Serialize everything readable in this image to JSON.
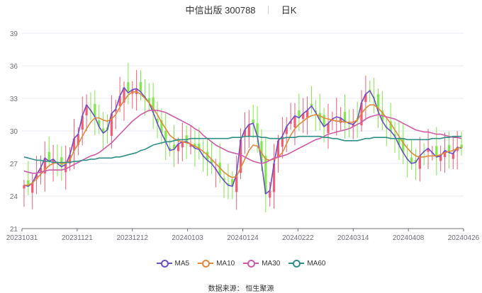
{
  "header": {
    "title": "中信出版 300788",
    "period": "日K"
  },
  "source": "数据来源： 恒生聚源",
  "colors": {
    "up": "#f25c74",
    "down": "#7fe84a",
    "grid": "#e6e9f0",
    "axis": "#6e7079",
    "ma5": "#6a4fc7",
    "ma10": "#e0893a",
    "ma30": "#d05aa8",
    "ma60": "#2f8f86"
  },
  "chart_data": {
    "type": "candlestick",
    "y_ticks": [
      21,
      24,
      27,
      30,
      33,
      36,
      39
    ],
    "ylim": [
      21,
      39
    ],
    "x_ticks": [
      "20231031",
      "20231121",
      "20231212",
      "20240103",
      "20240124",
      "20240222",
      "20240314",
      "20240408",
      "20240426"
    ],
    "legend": [
      "MA5",
      "MA10",
      "MA30",
      "MA60"
    ],
    "approx_close_path": [
      25.0,
      24.9,
      25.2,
      26.0,
      26.6,
      27.5,
      27.2,
      27.4,
      27.0,
      26.7,
      26.9,
      27.8,
      29.3,
      29.7,
      31.4,
      32.4,
      31.9,
      31.3,
      30.4,
      29.8,
      30.1,
      31.6,
      32.0,
      33.2,
      34.0,
      33.5,
      33.8,
      33.9,
      33.6,
      33.1,
      32.6,
      31.7,
      30.7,
      29.8,
      29.0,
      28.2,
      28.3,
      28.8,
      29.0,
      29.0,
      28.8,
      28.4,
      28.3,
      27.7,
      27.3,
      27.0,
      26.5,
      25.9,
      25.4,
      25.0,
      24.9,
      26.0,
      29.2,
      30.1,
      30.6,
      30.7,
      29.5,
      27.1,
      24.2,
      24.5,
      27.0,
      29.1,
      29.5,
      30.4,
      30.9,
      31.4,
      31.2,
      31.6,
      31.9,
      32.3,
      31.7,
      31.0,
      30.4,
      30.7,
      31.1,
      31.3,
      31.2,
      30.9,
      30.7,
      30.6,
      31.0,
      32.6,
      33.4,
      33.7,
      33.0,
      31.8,
      30.9,
      30.3,
      30.0,
      29.5,
      28.7,
      28.0,
      27.4,
      27.0,
      27.1,
      27.7,
      28.1,
      28.4,
      28.0,
      27.6,
      27.7,
      28.2,
      28.0,
      27.9,
      28.5,
      28.4
    ],
    "series": [
      {
        "name": "MA5",
        "values": [
          25.0,
          24.9,
          25.2,
          26.0,
          26.6,
          27.5,
          27.2,
          27.4,
          27.0,
          26.7,
          26.9,
          27.8,
          29.3,
          29.7,
          31.4,
          32.4,
          31.9,
          31.3,
          30.4,
          29.8,
          30.1,
          31.6,
          32.0,
          33.2,
          34.0,
          33.5,
          33.8,
          33.9,
          33.6,
          33.1,
          32.6,
          31.7,
          30.7,
          29.8,
          29.0,
          28.2,
          28.3,
          28.8,
          29.0,
          29.0,
          28.8,
          28.4,
          28.3,
          27.7,
          27.3,
          27.0,
          26.5,
          25.9,
          25.4,
          25.0,
          24.9,
          26.0,
          29.2,
          30.1,
          30.6,
          30.7,
          29.5,
          27.1,
          24.2,
          24.5,
          27.0,
          29.1,
          29.5,
          30.4,
          30.9,
          31.4,
          31.2,
          31.6,
          31.9,
          32.3,
          31.7,
          31.0,
          30.4,
          30.7,
          31.1,
          31.3,
          31.2,
          30.9,
          30.7,
          30.6,
          31.0,
          32.6,
          33.4,
          33.7,
          33.0,
          31.8,
          30.9,
          30.3,
          30.0,
          29.5,
          28.7,
          28.0,
          27.4,
          27.0,
          27.1,
          27.7,
          28.1,
          28.4,
          28.0,
          27.6,
          27.7,
          28.2,
          28.0,
          27.9,
          28.5,
          28.4
        ]
      },
      {
        "name": "MA10",
        "values": [
          25.0,
          25.0,
          25.2,
          25.6,
          26.0,
          26.4,
          26.8,
          27.0,
          27.1,
          27.0,
          27.0,
          27.3,
          28.2,
          28.8,
          29.5,
          30.2,
          30.8,
          31.2,
          31.2,
          31.0,
          30.9,
          31.1,
          31.5,
          32.2,
          32.8,
          33.3,
          33.6,
          33.6,
          33.4,
          33.0,
          32.6,
          32.1,
          31.5,
          30.8,
          30.2,
          29.6,
          29.3,
          29.1,
          29.0,
          28.9,
          28.8,
          28.6,
          28.4,
          28.1,
          27.8,
          27.4,
          27.0,
          26.6,
          26.2,
          25.9,
          25.7,
          25.8,
          26.6,
          27.4,
          28.2,
          28.7,
          28.6,
          28.0,
          27.4,
          27.3,
          27.4,
          27.6,
          28.0,
          28.8,
          29.6,
          30.2,
          30.6,
          30.9,
          31.2,
          31.4,
          31.5,
          31.4,
          31.2,
          31.1,
          31.0,
          30.9,
          30.9,
          30.8,
          30.8,
          30.8,
          31.0,
          31.6,
          32.1,
          32.4,
          32.4,
          32.1,
          31.7,
          31.2,
          30.7,
          30.1,
          29.5,
          28.9,
          28.4,
          28.0,
          27.7,
          27.6,
          27.6,
          27.7,
          27.7,
          27.7,
          27.8,
          28.0,
          28.1,
          28.2,
          28.4,
          28.5
        ]
      },
      {
        "name": "MA30",
        "values": [
          26.3,
          26.2,
          26.1,
          26.1,
          26.2,
          26.3,
          26.4,
          26.4,
          26.4,
          26.4,
          26.5,
          26.7,
          26.9,
          27.1,
          27.3,
          27.5,
          27.7,
          27.8,
          28.0,
          28.3,
          28.6,
          28.9,
          29.3,
          29.7,
          30.1,
          30.5,
          30.9,
          31.2,
          31.5,
          31.7,
          31.9,
          31.9,
          31.9,
          31.8,
          31.7,
          31.5,
          31.3,
          31.1,
          30.9,
          30.7,
          30.5,
          30.2,
          30.0,
          29.6,
          29.3,
          29.0,
          28.7,
          28.5,
          28.3,
          28.1,
          28.0,
          27.9,
          27.8,
          27.6,
          27.4,
          27.2,
          27.1,
          27.0,
          27.1,
          27.3,
          27.5,
          27.6,
          27.7,
          27.8,
          28.0,
          28.2,
          28.4,
          28.6,
          28.8,
          29.0,
          29.2,
          29.3,
          29.5,
          29.7,
          29.8,
          29.9,
          30.0,
          30.1,
          30.2,
          30.4,
          30.6,
          30.8,
          31.1,
          31.3,
          31.4,
          31.5,
          31.4,
          31.3,
          31.2,
          31.1,
          30.9,
          30.7,
          30.5,
          30.3,
          30.1,
          30.0,
          29.9,
          29.9,
          29.8,
          29.7,
          29.7,
          29.6,
          29.5,
          29.4,
          29.4,
          29.3
        ]
      },
      {
        "name": "MA60",
        "values": [
          27.6,
          27.5,
          27.4,
          27.3,
          27.3,
          27.2,
          27.2,
          27.1,
          27.1,
          27.1,
          27.1,
          27.1,
          27.2,
          27.2,
          27.3,
          27.3,
          27.4,
          27.4,
          27.5,
          27.5,
          27.5,
          27.5,
          27.6,
          27.6,
          27.7,
          27.8,
          27.9,
          28.0,
          28.2,
          28.3,
          28.5,
          28.7,
          28.8,
          28.9,
          29.0,
          29.0,
          29.1,
          29.2,
          29.2,
          29.2,
          29.3,
          29.3,
          29.3,
          29.3,
          29.3,
          29.3,
          29.3,
          29.3,
          29.3,
          29.3,
          29.4,
          29.4,
          29.4,
          29.5,
          29.5,
          29.5,
          29.5,
          29.4,
          29.4,
          29.3,
          29.3,
          29.3,
          29.3,
          29.4,
          29.4,
          29.4,
          29.5,
          29.5,
          29.5,
          29.5,
          29.5,
          29.5,
          29.4,
          29.4,
          29.3,
          29.3,
          29.2,
          29.1,
          29.1,
          29.1,
          29.1,
          29.2,
          29.3,
          29.3,
          29.4,
          29.4,
          29.4,
          29.4,
          29.3,
          29.3,
          29.3,
          29.3,
          29.2,
          29.2,
          29.2,
          29.2,
          29.2,
          29.2,
          29.3,
          29.3,
          29.3,
          29.4,
          29.4,
          29.5,
          29.5,
          29.5
        ]
      }
    ]
  }
}
